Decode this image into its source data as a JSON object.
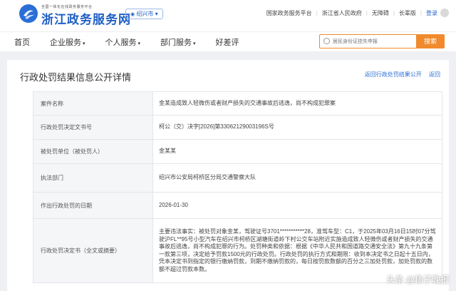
{
  "header": {
    "brand_small": "全国一体化在线政务服务平台",
    "brand_title": "浙江政务服务网",
    "city": "绍兴市",
    "links": [
      "国家政务服务平台",
      "浙江省人民政府",
      "无障碍",
      "长辈版"
    ],
    "login": "登录"
  },
  "nav": {
    "items": [
      "首页",
      "企业服务",
      "个人服务",
      "部门服务",
      "好差评"
    ],
    "search_placeholder": "居民身份证挂失申报",
    "search_button": "搜索"
  },
  "page": {
    "title": "行政处罚结果信息公开详情",
    "back_links": [
      "返回行政处罚结果公开",
      "返回"
    ]
  },
  "detail": {
    "rows": [
      {
        "label": "案件名称",
        "value": "金某造成致人轻微伤或者财产损失的交通事故后逃逸，尚不构成犯罪案"
      },
      {
        "label": "行政处罚决定文书号",
        "value": "柯公（交）决字[2026]第33062129003196S号"
      },
      {
        "label": "被处罚单位（被处罚人）",
        "value": "金某某"
      },
      {
        "label": "执法部门",
        "value": "绍兴市公安局柯桥区分局交通警察大队"
      },
      {
        "label": "作出行政处罚的日期",
        "value": "2026-01-30"
      },
      {
        "label": "行政处罚决定书（全文或摘要）",
        "value": "主要违法事实：被处罚对象金某，驾驶证号3701***********28，准驾车型：C1，于2025年03月16日15时07分驾驶沪FL**95号小型汽车在绍兴市柯桥区湖塘街道岭下村公交车站附近实施造成致人轻微伤或者财产损失的交通事故后逃逸，尚不构成犯罪的行为。处罚种类和依据：根据《中华人民共和国道路交通安全法》第九十九条第一款第三项，决定给予罚款1500元的行政处罚。行政处罚的执行方式和期限：收到本决定书之日起十五日内，凭本决定书到指定的银行缴纳罚款，到期不缴纳罚款的，每日按罚款数额的百分之三加处罚款，加处罚款的数额不超过罚款本数。"
      }
    ]
  },
  "watermark": "头条 @扬子晚报"
}
